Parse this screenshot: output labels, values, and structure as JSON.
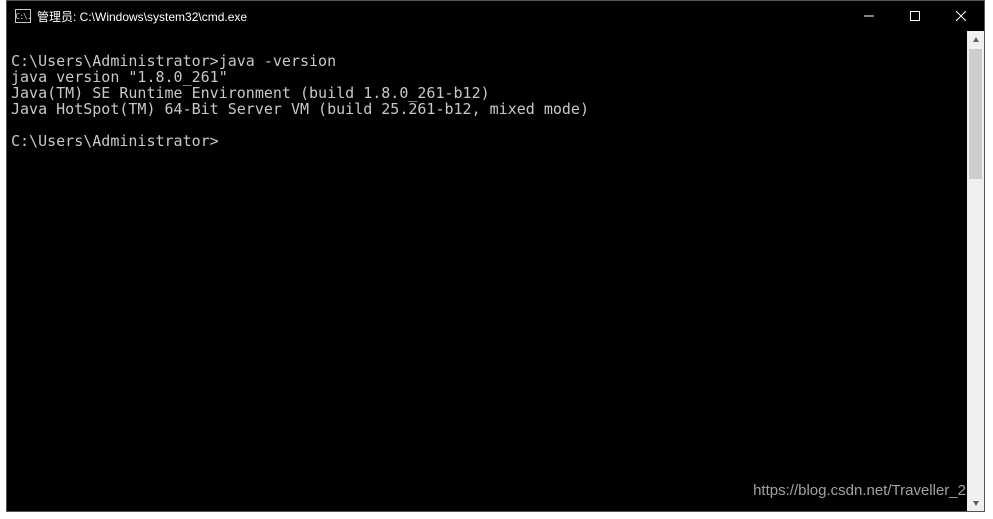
{
  "window": {
    "title": "管理员: C:\\Windows\\system32\\cmd.exe",
    "icon_label": "C:\\."
  },
  "terminal": {
    "lines": [
      "",
      "C:\\Users\\Administrator>java -version",
      "java version \"1.8.0_261\"",
      "Java(TM) SE Runtime Environment (build 1.8.0_261-b12)",
      "Java HotSpot(TM) 64-Bit Server VM (build 25.261-b12, mixed mode)",
      "",
      "C:\\Users\\Administrator>"
    ]
  },
  "watermark": "https://blog.csdn.net/Traveller_2",
  "colors": {
    "background": "#000000",
    "foreground": "#c8c8c8",
    "titlebar_fg": "#ffffff"
  }
}
